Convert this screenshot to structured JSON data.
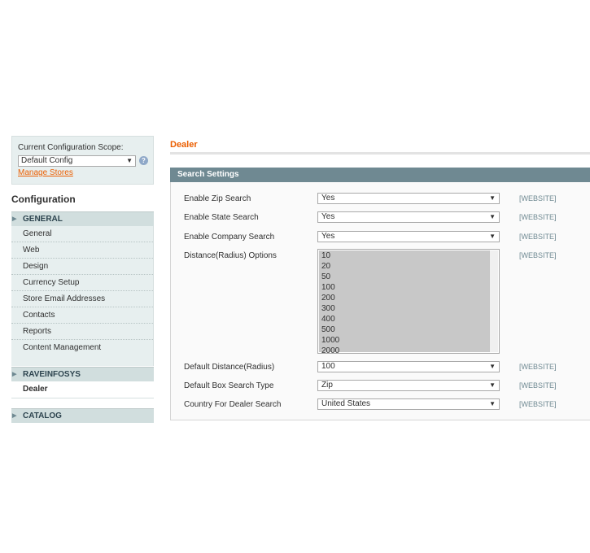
{
  "scope": {
    "label": "Current Configuration Scope:",
    "selected": "Default Config",
    "help": "?",
    "manage_link": "Manage Stores"
  },
  "config_title": "Configuration",
  "sidebar": {
    "general_head": "GENERAL",
    "general_items": [
      {
        "label": "General"
      },
      {
        "label": "Web"
      },
      {
        "label": "Design"
      },
      {
        "label": "Currency Setup"
      },
      {
        "label": "Store Email Addresses"
      },
      {
        "label": "Contacts"
      },
      {
        "label": "Reports"
      },
      {
        "label": "Content Management"
      }
    ],
    "raveinfosys_head": "RAVEINFOSYS",
    "dealer_item": "Dealer",
    "catalog_head": "CATALOG"
  },
  "main": {
    "title": "Dealer",
    "section_title": "Search Settings",
    "rows": [
      {
        "label": "Enable Zip Search",
        "value": "Yes",
        "scope": "[WEBSITE]"
      },
      {
        "label": "Enable State Search",
        "value": "Yes",
        "scope": "[WEBSITE]"
      },
      {
        "label": "Enable Company Search",
        "value": "Yes",
        "scope": "[WEBSITE]"
      },
      {
        "label": "Distance(Radius) Options",
        "scope": "[WEBSITE]"
      },
      {
        "label": "Default Distance(Radius)",
        "value": "100",
        "scope": "[WEBSITE]"
      },
      {
        "label": "Default Box Search Type",
        "value": "Zip",
        "scope": "[WEBSITE]"
      },
      {
        "label": "Country For Dealer Search",
        "value": "United States",
        "scope": "[WEBSITE]"
      }
    ],
    "radius_options": [
      "10",
      "20",
      "50",
      "100",
      "200",
      "300",
      "400",
      "500",
      "1000",
      "2000"
    ]
  },
  "icons": {
    "dropdown": "▼",
    "collapsed": "▶"
  },
  "colors": {
    "accent": "#eb5e00",
    "section_header": "#6f8992",
    "sidebar_bg": "#e7efef"
  }
}
